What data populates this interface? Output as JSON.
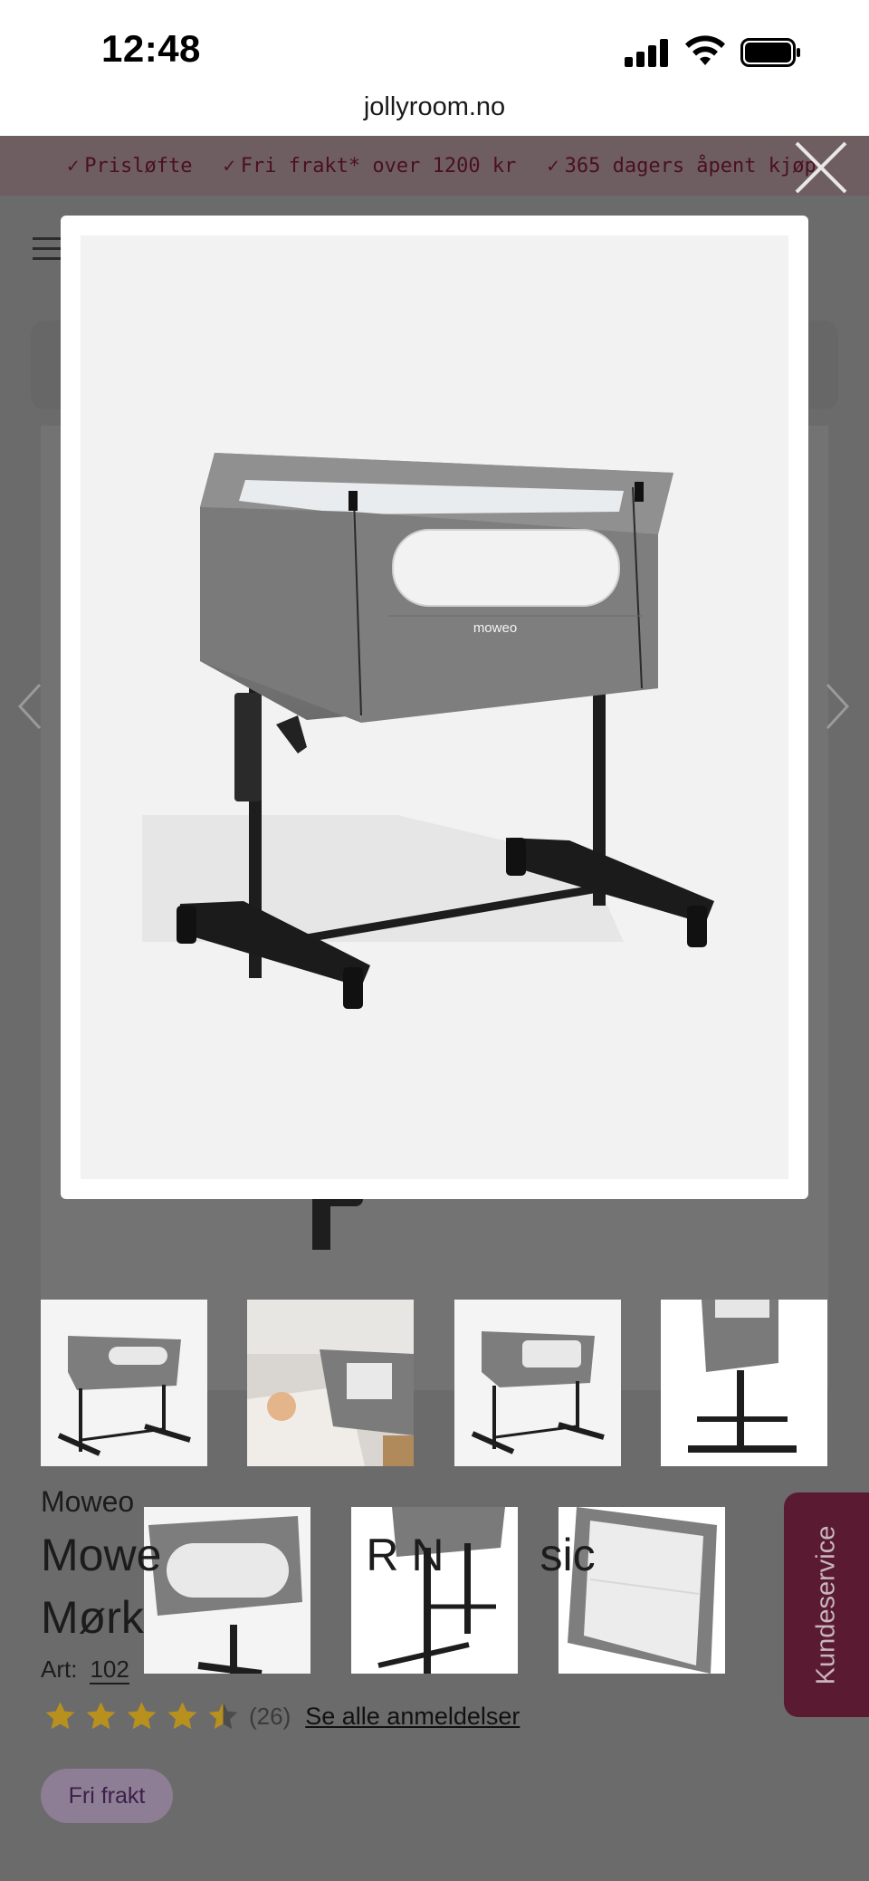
{
  "status_bar": {
    "time": "12:48",
    "icons": [
      "signal-icon",
      "wifi-icon",
      "battery-icon"
    ]
  },
  "browser": {
    "url": "jollyroom.no"
  },
  "promo_bar": {
    "items": [
      "Prisløfte",
      "Fri frakt* over 1200 kr",
      "365 dagers åpent kjøp"
    ],
    "check_icon": "check-icon"
  },
  "gallery": {
    "close_icon": "close-icon",
    "prev_icon": "chevron-left-icon",
    "next_icon": "chevron-right-icon",
    "main_image_brand_text": "moweo",
    "thumbnail_count": 7
  },
  "product": {
    "brand": "Moweo",
    "title_line1_visible_start": "Mowe",
    "title_line1_visible_mid": "R N",
    "title_line1_visible_end": "sic",
    "title_line2_visible": "Mørk",
    "art_label": "Art:",
    "art_number_visible": "102",
    "rating": {
      "value": 4.5,
      "max": 5,
      "count": "(26)",
      "link": "Se alle anmeldelser"
    },
    "badge": "Fri frakt"
  },
  "customer_service": {
    "label": "Kundeservice"
  },
  "colors": {
    "overlay": "#6e6e6e",
    "brand": "#5a1a32",
    "star": "#b8901e",
    "badge": "#8e7e95"
  }
}
